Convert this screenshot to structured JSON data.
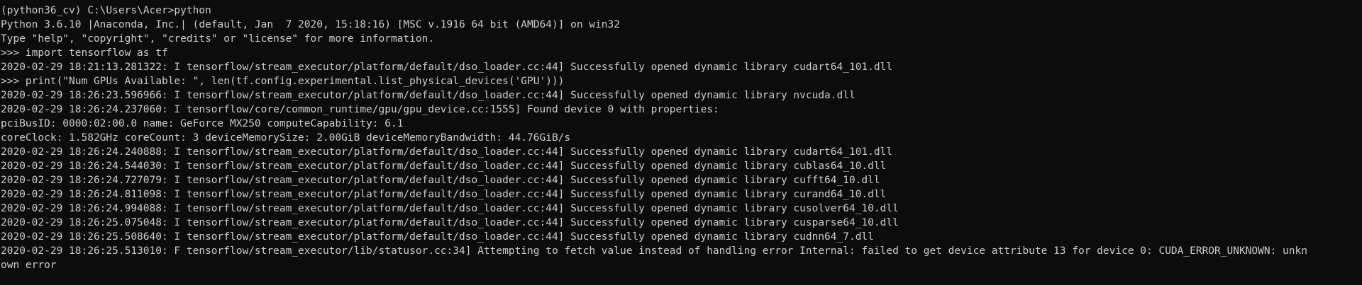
{
  "terminal": {
    "lines": [
      "(python36_cv) C:\\Users\\Acer>python",
      "Python 3.6.10 |Anaconda, Inc.| (default, Jan  7 2020, 15:18:16) [MSC v.1916 64 bit (AMD64)] on win32",
      "Type \"help\", \"copyright\", \"credits\" or \"license\" for more information.",
      ">>> import tensorflow as tf",
      "2020-02-29 18:21:13.281322: I tensorflow/stream_executor/platform/default/dso_loader.cc:44] Successfully opened dynamic library cudart64_101.dll",
      ">>> print(\"Num GPUs Available: \", len(tf.config.experimental.list_physical_devices('GPU')))",
      "2020-02-29 18:26:23.596966: I tensorflow/stream_executor/platform/default/dso_loader.cc:44] Successfully opened dynamic library nvcuda.dll",
      "2020-02-29 18:26:24.237060: I tensorflow/core/common_runtime/gpu/gpu_device.cc:1555] Found device 0 with properties:",
      "pciBusID: 0000:02:00.0 name: GeForce MX250 computeCapability: 6.1",
      "coreClock: 1.582GHz coreCount: 3 deviceMemorySize: 2.00GiB deviceMemoryBandwidth: 44.76GiB/s",
      "2020-02-29 18:26:24.240888: I tensorflow/stream_executor/platform/default/dso_loader.cc:44] Successfully opened dynamic library cudart64_101.dll",
      "2020-02-29 18:26:24.544030: I tensorflow/stream_executor/platform/default/dso_loader.cc:44] Successfully opened dynamic library cublas64_10.dll",
      "2020-02-29 18:26:24.727079: I tensorflow/stream_executor/platform/default/dso_loader.cc:44] Successfully opened dynamic library cufft64_10.dll",
      "2020-02-29 18:26:24.811098: I tensorflow/stream_executor/platform/default/dso_loader.cc:44] Successfully opened dynamic library curand64_10.dll",
      "2020-02-29 18:26:24.994088: I tensorflow/stream_executor/platform/default/dso_loader.cc:44] Successfully opened dynamic library cusolver64_10.dll",
      "2020-02-29 18:26:25.075048: I tensorflow/stream_executor/platform/default/dso_loader.cc:44] Successfully opened dynamic library cusparse64_10.dll",
      "2020-02-29 18:26:25.508640: I tensorflow/stream_executor/platform/default/dso_loader.cc:44] Successfully opened dynamic library cudnn64_7.dll",
      "2020-02-29 18:26:25.513010: F tensorflow/stream_executor/lib/statusor.cc:34] Attempting to fetch value instead of handling error Internal: failed to get device attribute 13 for device 0: CUDA_ERROR_UNKNOWN: unkn",
      "own error"
    ]
  }
}
